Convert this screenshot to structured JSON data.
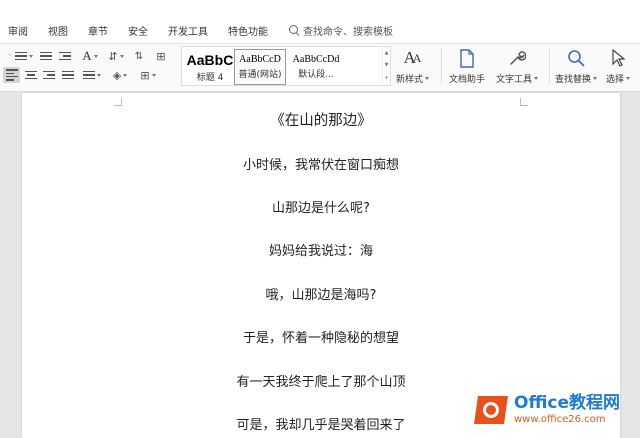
{
  "menu": {
    "items": [
      "审阅",
      "视图",
      "章节",
      "安全",
      "开发工具",
      "特色功能"
    ],
    "search_text": "查找命令、搜索模板"
  },
  "styles": [
    {
      "sample": "AaBbC",
      "name": "标题 4"
    },
    {
      "sample": "AaBbCcD",
      "name": "普通(网站)"
    },
    {
      "sample": "AaBbCcDd",
      "name": "默认段..."
    }
  ],
  "tools": {
    "new_style": "新样式",
    "doc_assistant": "文档助手",
    "text_tools": "文字工具",
    "find_replace": "查找替换",
    "select": "选择"
  },
  "document": {
    "title": "《在山的那边》",
    "lines": [
      "小时候，我常伏在窗口痴想",
      "山那边是什么呢?",
      "妈妈给我说过：海",
      "哦，山那边是海吗?",
      "于是，怀着一种隐秘的想望",
      "有一天我终于爬上了那个山顶",
      "可是，我却几乎是哭着回来了"
    ]
  },
  "watermark": {
    "title": "Office教程网",
    "url": "www.office26.com"
  },
  "colors": {
    "logo_orange": "#e8511c",
    "brand_blue": "#1f7bd1"
  }
}
